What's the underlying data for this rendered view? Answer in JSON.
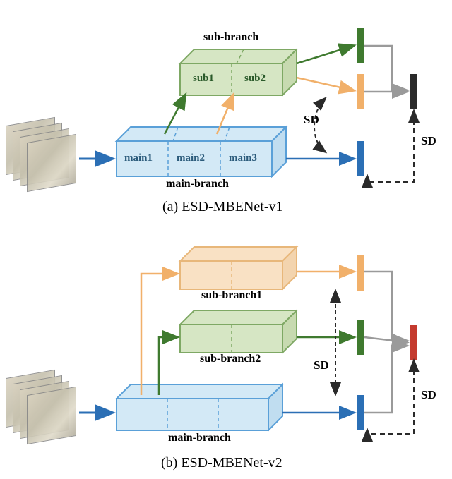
{
  "figure_a": {
    "caption": "(a) ESD-MBENet-v1",
    "subbranch_title": "sub-branch",
    "mainbranch_title": "main-branch",
    "sub_segments": [
      "sub1",
      "sub2"
    ],
    "main_segments": [
      "main1",
      "main2",
      "main3"
    ],
    "sd_label_inner": "SD",
    "sd_label_outer": "SD"
  },
  "figure_b": {
    "caption": "(b) ESD-MBENet-v2",
    "subbranch1_title": "sub-branch1",
    "subbranch2_title": "sub-branch2",
    "mainbranch_title": "main-branch",
    "sd_label_inner": "SD",
    "sd_label_outer": "SD"
  },
  "colors": {
    "blue_stroke": "#5aa0d8",
    "blue_fill": "#d3e9f6",
    "green_stroke": "#7ea864",
    "green_fill": "#d6e6c4",
    "orange_stroke": "#e8b77a",
    "orange_fill": "#f9e1c4",
    "dark_green": "#3f7a2f",
    "dark_orange": "#f1b06a",
    "dark_blue": "#2b6fb5",
    "black": "#2a2a2a",
    "red": "#c43a2e",
    "gray": "#9a9a9a"
  }
}
